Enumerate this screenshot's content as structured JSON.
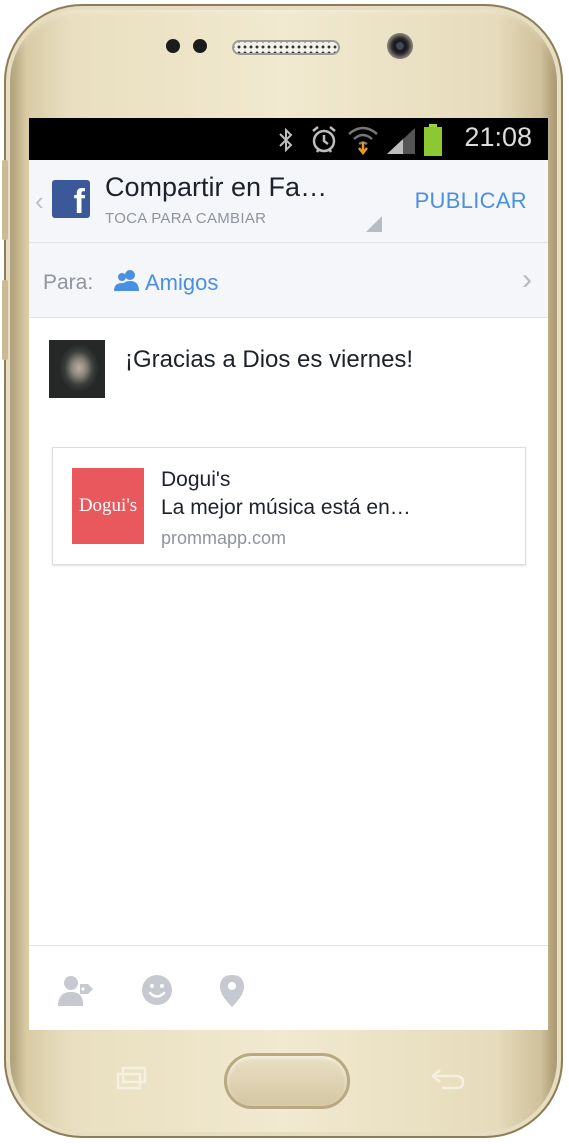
{
  "status_bar": {
    "time": "21:08"
  },
  "header": {
    "title": "Compartir en Fa…",
    "subtitle": "TOCA PARA CAMBIAR",
    "publish_label": "PUBLICAR",
    "app_icon": "facebook-icon"
  },
  "audience": {
    "prefix": "Para:",
    "value": "Amigos"
  },
  "post": {
    "text": "¡Gracias a Dios es viernes!"
  },
  "link_card": {
    "thumbnail_text": "Dogui's",
    "thumbnail_color": "#e9585d",
    "title": "Dogui's",
    "description": "La mejor música está en…",
    "domain": "prommapp.com"
  },
  "toolbar": {
    "icons": [
      "tag-people-icon",
      "feeling-icon",
      "location-icon"
    ]
  },
  "colors": {
    "accent": "#4a90e2",
    "facebook": "#3b5998"
  }
}
